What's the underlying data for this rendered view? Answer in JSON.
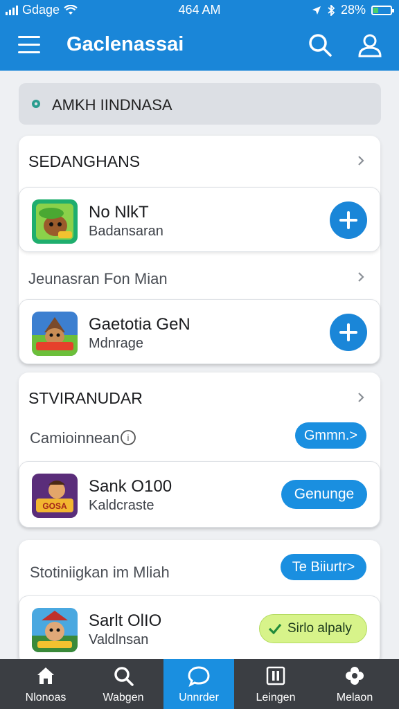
{
  "status_bar": {
    "carrier": "Gdage",
    "time": "464 AM",
    "battery": "28%",
    "battery_level": 0.28
  },
  "app_bar": {
    "title": "Gaclenassai",
    "menu_icon": "hamburger-icon",
    "search_icon": "search-icon",
    "profile_icon": "user-icon"
  },
  "search": {
    "icon": "location-pin-icon",
    "text": "AMKH IINDNASA"
  },
  "section1": {
    "header": "SEDANGHANS",
    "item1": {
      "name": "No NlkT",
      "sub": "Badansaran"
    },
    "subheader": "Jeunasran Fon Mian",
    "item2": {
      "name": "Gaetotia GeN",
      "sub": "Mdnrage"
    }
  },
  "section2": {
    "header": "STVIRANUDAR",
    "subrow": {
      "label": "Camioinnean",
      "pill": "Gmmn.>"
    },
    "item": {
      "name": "Sank O100",
      "sub": "Kaldcraste",
      "button": "Genunge"
    }
  },
  "section3": {
    "subrow": {
      "label": "Stotiniigkan im Mliah",
      "pill": "Te Biiurtr>"
    },
    "item": {
      "name": "Sarlt OlIO",
      "sub": "Valdlnsan",
      "badge": "Sirlo alpaly"
    }
  },
  "bottom_nav": [
    {
      "label": "Nlonoas",
      "icon": "home-icon"
    },
    {
      "label": "Wabgen",
      "icon": "search-icon"
    },
    {
      "label": "Unnrder",
      "icon": "chat-bubble-icon"
    },
    {
      "label": "Leingen",
      "icon": "library-icon"
    },
    {
      "label": "Melaon",
      "icon": "flower-icon"
    }
  ],
  "colors": {
    "primary": "#1a86d8",
    "nav_bg": "#3b3e43",
    "badge_green": "#d7f38a"
  }
}
